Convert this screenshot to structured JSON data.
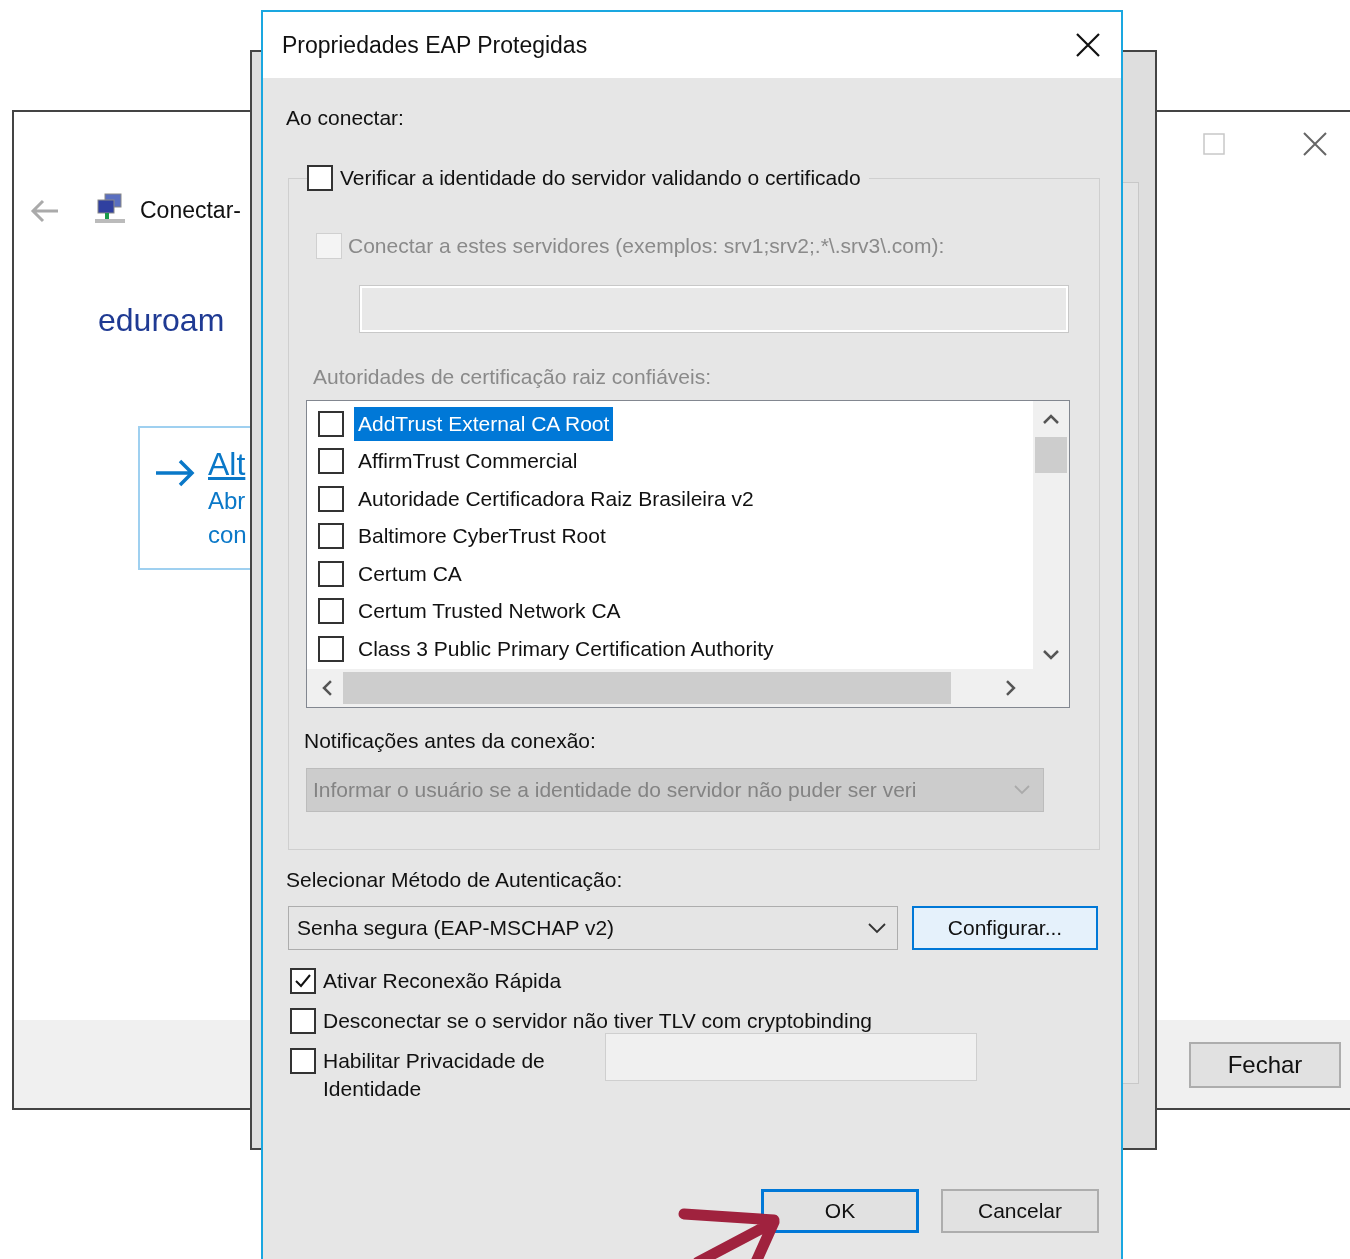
{
  "back_window": {
    "heading": "Conectar-",
    "network_name": "eduroam",
    "link": {
      "title": "Alt",
      "line_1": "Abr",
      "line_2": "con"
    },
    "close_button": "Fechar"
  },
  "dialog": {
    "title": "Propriedades EAP Protegidas",
    "on_connect_label": "Ao conectar:",
    "verify_server": {
      "label": "Verificar a identidade do servidor validando o certificado",
      "checked": false
    },
    "connect_servers": {
      "label": "Conectar a estes servidores (exemplos: srv1;srv2;.*\\.srv3\\.com):",
      "checked": false,
      "disabled": true
    },
    "servers_field": {
      "disabled": true
    },
    "ca_label": {
      "text": "Autoridades de certificação raiz confiáveis:",
      "disabled": true
    },
    "ca_list": [
      {
        "label": "AddTrust External CA Root",
        "checked": false,
        "selected": true
      },
      {
        "label": "AffirmTrust Commercial",
        "checked": false,
        "selected": false
      },
      {
        "label": "Autoridade Certificadora Raiz Brasileira v2",
        "checked": false,
        "selected": false
      },
      {
        "label": "Baltimore CyberTrust Root",
        "checked": false,
        "selected": false
      },
      {
        "label": "Certum CA",
        "checked": false,
        "selected": false
      },
      {
        "label": "Certum Trusted Network CA",
        "checked": false,
        "selected": false
      },
      {
        "label": "Class 3 Public Primary Certification Authority",
        "checked": false,
        "selected": false
      }
    ],
    "notifications": {
      "label": "Notificações antes da conexão:",
      "value": "Informar o usuário se a identidade do servidor não puder ser veri",
      "disabled": true
    },
    "auth_method": {
      "label": "Selecionar Método de Autenticação:",
      "value": "Senha segura (EAP-MSCHAP v2)",
      "configure_button": "Configurar..."
    },
    "options": [
      {
        "kind": "checkbox",
        "label": "Ativar Reconexão Rápida",
        "checked": true
      },
      {
        "kind": "checkbox",
        "label": "Desconectar se o servidor não tiver TLV com cryptobinding",
        "checked": false
      },
      {
        "kind": "checkbox_field",
        "label": "Habilitar Privacidade de Identidade",
        "checked": false
      }
    ],
    "buttons": [
      {
        "label": "OK",
        "default": true
      },
      {
        "label": "Cancelar",
        "default": false
      }
    ]
  }
}
